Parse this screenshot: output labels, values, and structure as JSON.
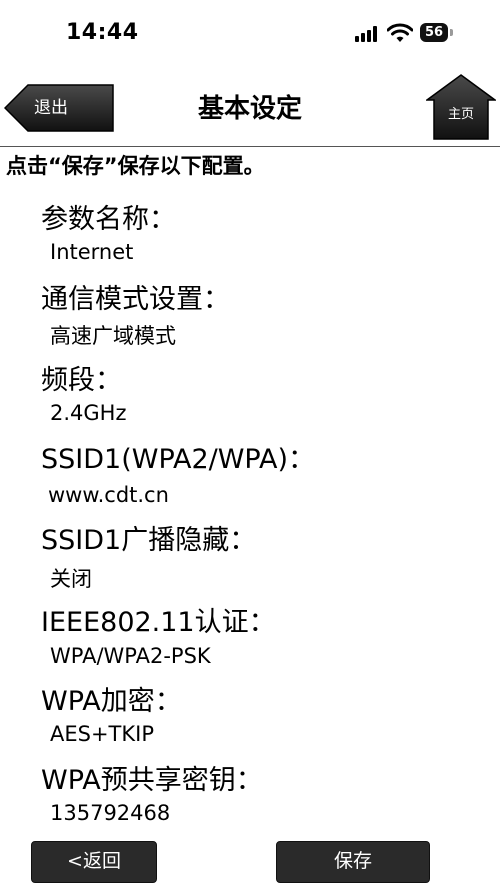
{
  "status": {
    "time": "14:44",
    "battery": "56"
  },
  "nav": {
    "back": "退出",
    "title": "基本设定",
    "home": "主页"
  },
  "instruction": "点击“保存”保存以下配置。",
  "params": [
    {
      "label": "参数名称：",
      "value": "Internet"
    },
    {
      "label": "通信模式设置：",
      "value": "高速广域模式"
    },
    {
      "label": "频段：",
      "value": "2.4GHz"
    },
    {
      "label": "SSID1(WPA2/WPA)：",
      "value": "www.cdt.cn"
    },
    {
      "label": "SSID1广播隐藏：",
      "value": "关闭"
    },
    {
      "label": "IEEE802.11认证：",
      "value": "WPA/WPA2-PSK"
    },
    {
      "label": "WPA加密：",
      "value": "AES+TKIP"
    },
    {
      "label": "WPA预共享密钥：",
      "value": "135792468"
    }
  ],
  "buttons": {
    "back": "<返回",
    "save": "保存"
  }
}
